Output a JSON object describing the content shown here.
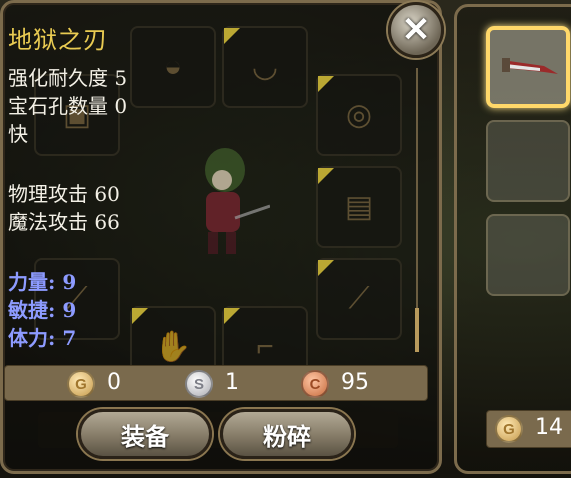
{
  "item": {
    "name": "地狱之刃",
    "stats": [
      "强化耐久度 5",
      "宝石孔数量 0",
      "快"
    ],
    "attack": [
      "物理攻击 60",
      "魔法攻击 66"
    ],
    "attributes": [
      "力量: 9",
      "敏捷: 9",
      "体力: 7"
    ]
  },
  "price": {
    "gold": "0",
    "silver": "1",
    "copper": "95",
    "gold_letter": "G",
    "silver_letter": "S",
    "copper_letter": "C"
  },
  "actions": {
    "equip_label": "装备",
    "shatter_label": "粉碎"
  },
  "side": {
    "coin_letter": "G",
    "coin_count": "14"
  },
  "close_symbol": "✕",
  "colors": {
    "title": "#e9cb52",
    "attributes": "#8d9bff",
    "stats": "#f3f0e6",
    "selected_border": "#ffd86a"
  }
}
